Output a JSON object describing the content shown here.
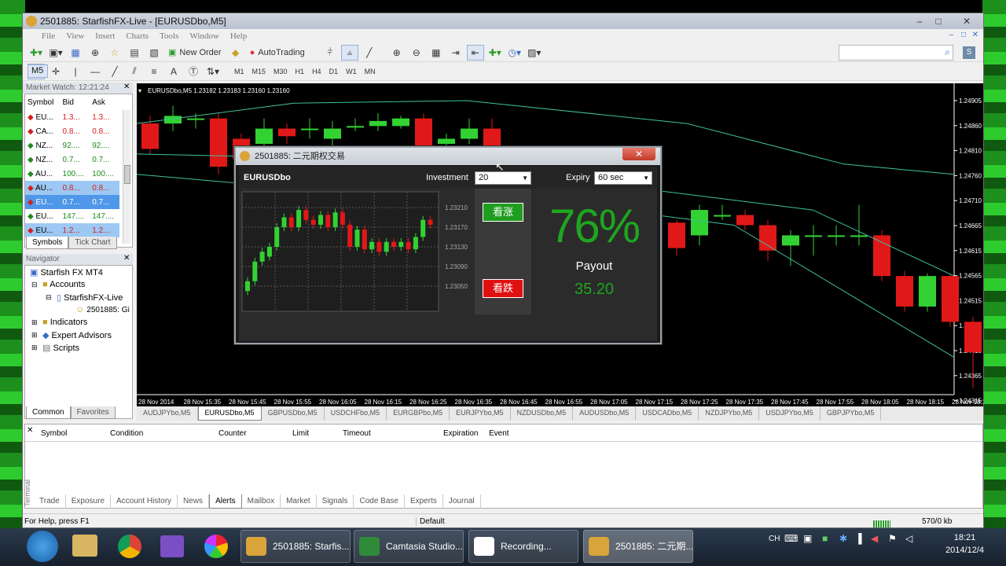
{
  "window": {
    "title": "2501885: StarfishFX-Live - [EURUSDbo,M5]"
  },
  "menu": [
    "File",
    "View",
    "Insert",
    "Charts",
    "Tools",
    "Window",
    "Help"
  ],
  "toolbar": {
    "new_order": "New Order",
    "autotrading": "AutoTrading"
  },
  "timeframes": [
    "M1",
    "M5",
    "M15",
    "M30",
    "H1",
    "H4",
    "D1",
    "W1",
    "MN"
  ],
  "market_watch": {
    "title": "Market Watch: 12:21:24",
    "headers": [
      "Symbol",
      "Bid",
      "Ask"
    ],
    "rows": [
      {
        "s": "EU...",
        "b": "1.3...",
        "a": "1.3...",
        "dir": "dn"
      },
      {
        "s": "CA...",
        "b": "0.8...",
        "a": "0.8...",
        "dir": "dn"
      },
      {
        "s": "NZ...",
        "b": "92....",
        "a": "92....",
        "dir": "up"
      },
      {
        "s": "NZ...",
        "b": "0.7...",
        "a": "0.7...",
        "dir": "up"
      },
      {
        "s": "AU...",
        "b": "100....",
        "a": "100....",
        "dir": "up"
      },
      {
        "s": "AU...",
        "b": "0.8...",
        "a": "0.8...",
        "dir": "dn"
      },
      {
        "s": "EU...",
        "b": "0.7...",
        "a": "0.7...",
        "dir": "dn"
      },
      {
        "s": "EU...",
        "b": "147....",
        "a": "147....",
        "dir": "up"
      },
      {
        "s": "EU...",
        "b": "1.2...",
        "a": "1.2...",
        "dir": "dn"
      }
    ],
    "tabs": [
      "Symbols",
      "Tick Chart"
    ]
  },
  "navigator": {
    "title": "Navigator",
    "root": "Starfish FX MT4",
    "accounts": "Accounts",
    "server": "StarfishFX-Live",
    "account": "2501885: Gi",
    "indicators": "Indicators",
    "experts": "Expert Advisors",
    "scripts": "Scripts",
    "tabs": [
      "Common",
      "Favorites"
    ]
  },
  "chart": {
    "header": "EURUSDbo,M5  1.23182 1.23183 1.23160 1.23160",
    "price_labels": [
      "1.24905",
      "1.24860",
      "1.24810",
      "1.24760",
      "1.24710",
      "1.24665",
      "1.24615",
      "1.24565",
      "1.24515",
      "1.24465",
      "1.24415",
      "1.24365",
      "1.24315"
    ],
    "time_labels": [
      "28 Nov 2014",
      "28 Nov 15:35",
      "28 Nov 15:45",
      "28 Nov 15:55",
      "28 Nov 16:05",
      "28 Nov 16:15",
      "28 Nov 16:25",
      "28 Nov 16:35",
      "28 Nov 16:45",
      "28 Nov 16:55",
      "28 Nov 17:05",
      "28 Nov 17:15",
      "28 Nov 17:25",
      "28 Nov 17:35",
      "28 Nov 17:45",
      "28 Nov 17:55",
      "28 Nov 18:05",
      "28 Nov 18:15",
      "28 Nov 18:2"
    ]
  },
  "chart_tabs": [
    "AUDJPYbo,M5",
    "EURUSDbo,M5",
    "GBPUSDbo,M5",
    "USDCHFbo,M5",
    "EURGBPbo,M5",
    "EURJPYbo,M5",
    "NZDUSDbo,M5",
    "AUDUSDbo,M5",
    "USDCADbo,M5",
    "NZDJPYbo,M5",
    "USDJPYbo,M5",
    "GBPJPYbo,M5"
  ],
  "terminal": {
    "headers": [
      "Symbol",
      "Condition",
      "Counter",
      "Limit",
      "Timeout",
      "Expiration",
      "Event"
    ],
    "side_label": "Terminal",
    "tabs": [
      "Trade",
      "Exposure",
      "Account History",
      "News",
      "Alerts",
      "Mailbox",
      "Market",
      "Signals",
      "Code Base",
      "Experts",
      "Journal"
    ]
  },
  "status": {
    "help": "For Help, press F1",
    "profile": "Default",
    "traffic": "570/0 kb"
  },
  "dialog": {
    "title": "2501885: 二元期权交易",
    "symbol": "EURUSDbo",
    "investment_label": "Investment",
    "investment": "20",
    "expiry_label": "Expiry",
    "expiry": "60 sec",
    "prices": [
      "1.23210",
      "1.23170",
      "1.23130",
      "1.23090",
      "1.23050"
    ],
    "up_label": "看涨",
    "down_label": "看跌",
    "percent": "76%",
    "payout_label": "Payout",
    "payout": "35.20"
  },
  "taskbar": {
    "items": [
      "2501885: Starfis...",
      "Camtasia Studio...",
      "Recording...",
      "2501885: 二元期..."
    ],
    "lang": "CH",
    "time": "18:21",
    "date": "2014/12/4"
  }
}
